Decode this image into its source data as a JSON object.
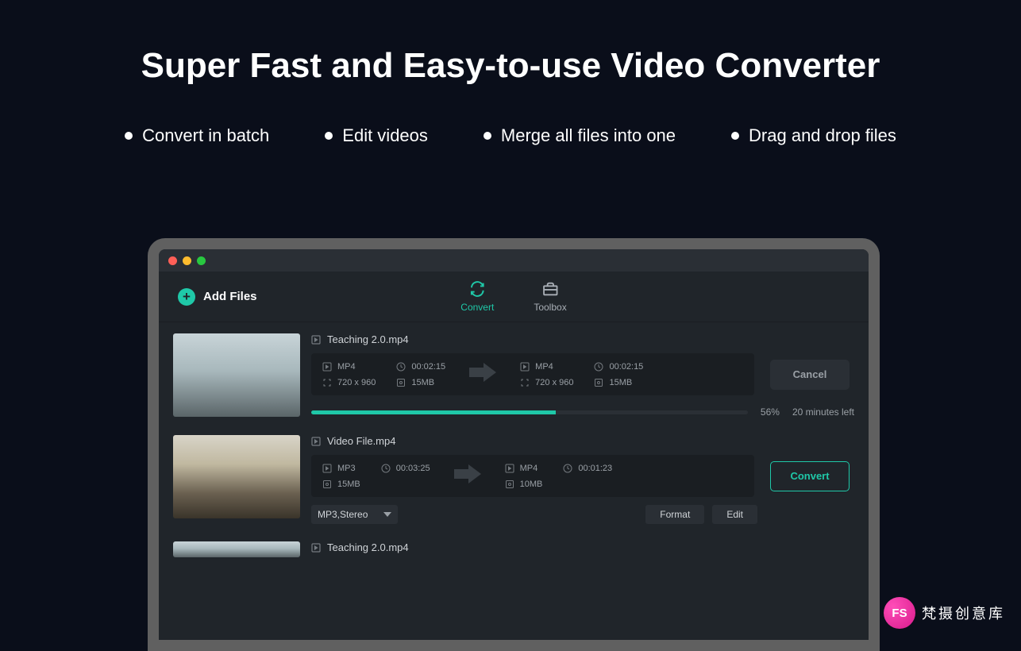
{
  "hero": {
    "title": "Super Fast and Easy-to-use Video Converter",
    "features": [
      "Convert in batch",
      "Edit videos",
      "Merge all files into one",
      "Drag and drop files"
    ]
  },
  "toolbar": {
    "add_files": "Add Files"
  },
  "tabs": {
    "convert": "Convert",
    "toolbox": "Toolbox"
  },
  "files": [
    {
      "name": "Teaching 2.0.mp4",
      "src": {
        "format": "MP4",
        "duration": "00:02:15",
        "resolution": "720 x 960",
        "size": "15MB"
      },
      "dst": {
        "format": "MP4",
        "duration": "00:02:15",
        "resolution": "720 x 960",
        "size": "15MB"
      },
      "action": "Cancel",
      "progress": {
        "percent": "56%",
        "eta": "20 minutes left"
      }
    },
    {
      "name": "Video File.mp4",
      "src": {
        "format": "MP3",
        "duration": "00:03:25",
        "size": "15MB"
      },
      "dst": {
        "format": "MP4",
        "duration": "00:01:23",
        "size": "10MB"
      },
      "action": "Convert",
      "dropdown": "MP3,Stereo",
      "format_btn": "Format",
      "edit_btn": "Edit"
    },
    {
      "name": "Teaching 2.0.mp4"
    }
  ],
  "watermark": {
    "badge": "FS",
    "text": "梵摄创意库"
  }
}
